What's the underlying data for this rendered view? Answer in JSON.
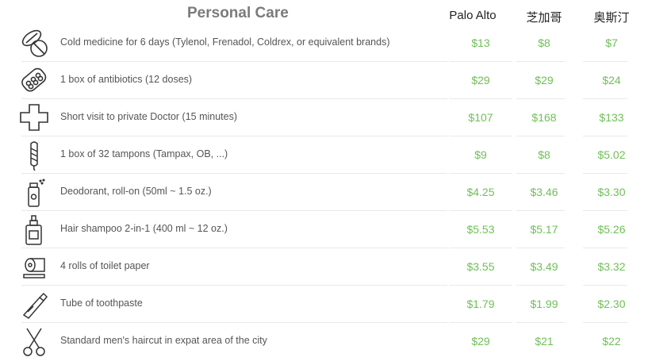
{
  "title": "Personal Care",
  "columns": [
    "Palo Alto",
    "芝加哥",
    "奥斯汀"
  ],
  "rows": [
    {
      "icon": "pills-icon",
      "desc": "Cold medicine for 6 days (Tylenol, Frenadol, Coldrex, or equivalent brands)",
      "prices": [
        "$13",
        "$8",
        "$7"
      ]
    },
    {
      "icon": "blister-pack-icon",
      "desc": "1 box of antibiotics (12 doses)",
      "prices": [
        "$29",
        "$29",
        "$24"
      ]
    },
    {
      "icon": "medical-cross-icon",
      "desc": "Short visit to private Doctor (15 minutes)",
      "prices": [
        "$107",
        "$168",
        "$133"
      ]
    },
    {
      "icon": "tampon-icon",
      "desc": "1 box of 32 tampons (Tampax, OB, ...)",
      "prices": [
        "$9",
        "$8",
        "$5.02"
      ]
    },
    {
      "icon": "deodorant-icon",
      "desc": "Deodorant, roll-on (50ml ~ 1.5 oz.)",
      "prices": [
        "$4.25",
        "$3.46",
        "$3.30"
      ]
    },
    {
      "icon": "shampoo-bottle-icon",
      "desc": "Hair shampoo 2-in-1 (400 ml ~ 12 oz.)",
      "prices": [
        "$5.53",
        "$5.17",
        "$5.26"
      ]
    },
    {
      "icon": "toilet-paper-icon",
      "desc": "4 rolls of toilet paper",
      "prices": [
        "$3.55",
        "$3.49",
        "$3.32"
      ]
    },
    {
      "icon": "toothpaste-icon",
      "desc": "Tube of toothpaste",
      "prices": [
        "$1.79",
        "$1.99",
        "$2.30"
      ]
    },
    {
      "icon": "scissors-icon",
      "desc": "Standard men's haircut in expat area of the city",
      "prices": [
        "$29",
        "$21",
        "$22"
      ]
    }
  ]
}
